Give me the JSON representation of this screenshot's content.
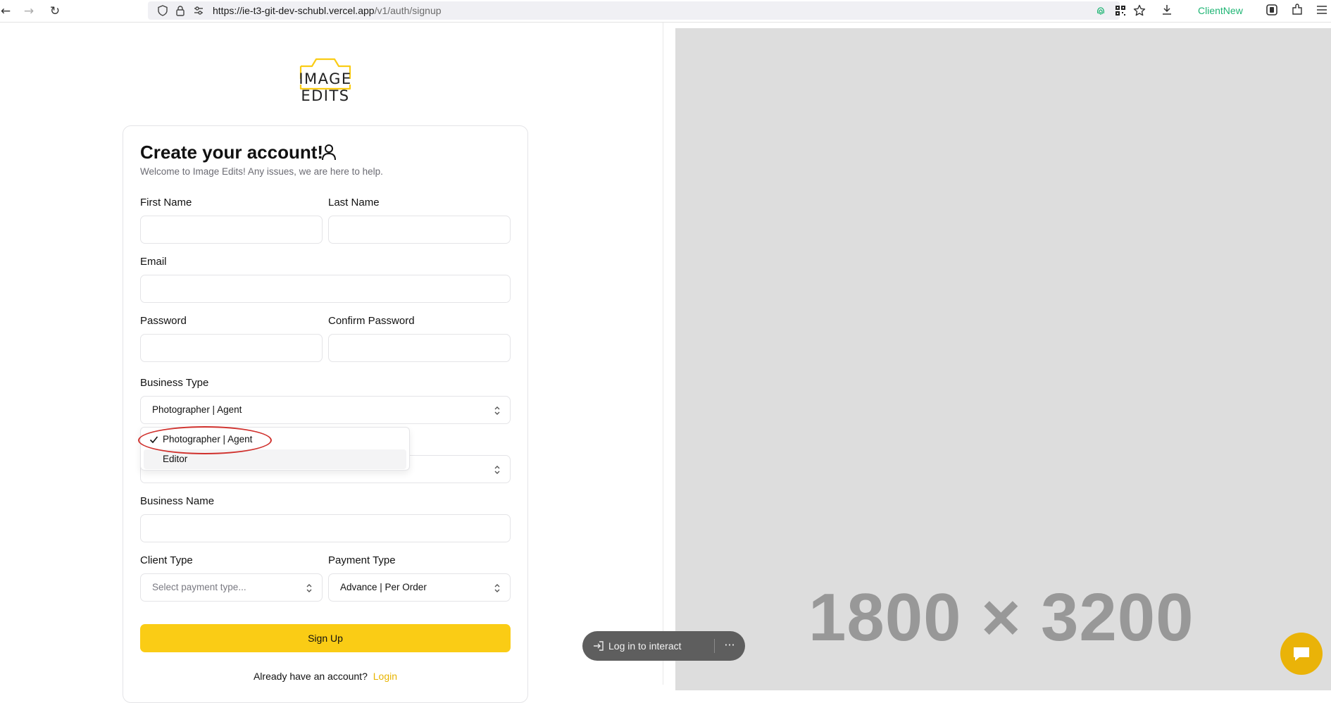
{
  "browser": {
    "back_icon": "←",
    "forward_icon": "→",
    "reload_icon": "↻",
    "url_host": "https://ie-t3-git-dev-schubl.vercel.app",
    "url_path": "/v1/auth/signup",
    "extension_label": "ClientNew",
    "icons": [
      "shield-icon",
      "lock-icon",
      "permissions-icon",
      "qr-icon",
      "star-icon",
      "download-icon",
      "pocket-icon",
      "extensions-icon",
      "menu-icon"
    ]
  },
  "logo": {
    "text": "IMAGE EDITS"
  },
  "form": {
    "title": "Create your account!",
    "subtitle": "Welcome to Image Edits! Any issues, we are here to help.",
    "first_name_label": "First Name",
    "last_name_label": "Last Name",
    "email_label": "Email",
    "password_label": "Password",
    "confirm_password_label": "Confirm Password",
    "business_type_label": "Business Type",
    "business_type_value": "Photographer | Agent",
    "business_name_label": "Business Name",
    "client_type_label": "Client Type",
    "client_type_placeholder": "Select payment type...",
    "payment_type_label": "Payment Type",
    "payment_type_value": "Advance | Per Order",
    "signup_button": "Sign Up",
    "have_account_text": "Already have an account?",
    "login_link": "Login"
  },
  "dropdown": {
    "options": [
      {
        "label": "Photographer | Agent",
        "selected": true
      },
      {
        "label": "Editor",
        "selected": false
      }
    ]
  },
  "placeholder_image": {
    "text": "1800 × 3200"
  },
  "overlay": {
    "login_to_interact": "Log in to interact",
    "more_icon": "···"
  },
  "colors": {
    "accent": "#facc15",
    "login_link": "#e8b400",
    "annotation": "#d0312d",
    "extension_green": "#1fb574"
  }
}
